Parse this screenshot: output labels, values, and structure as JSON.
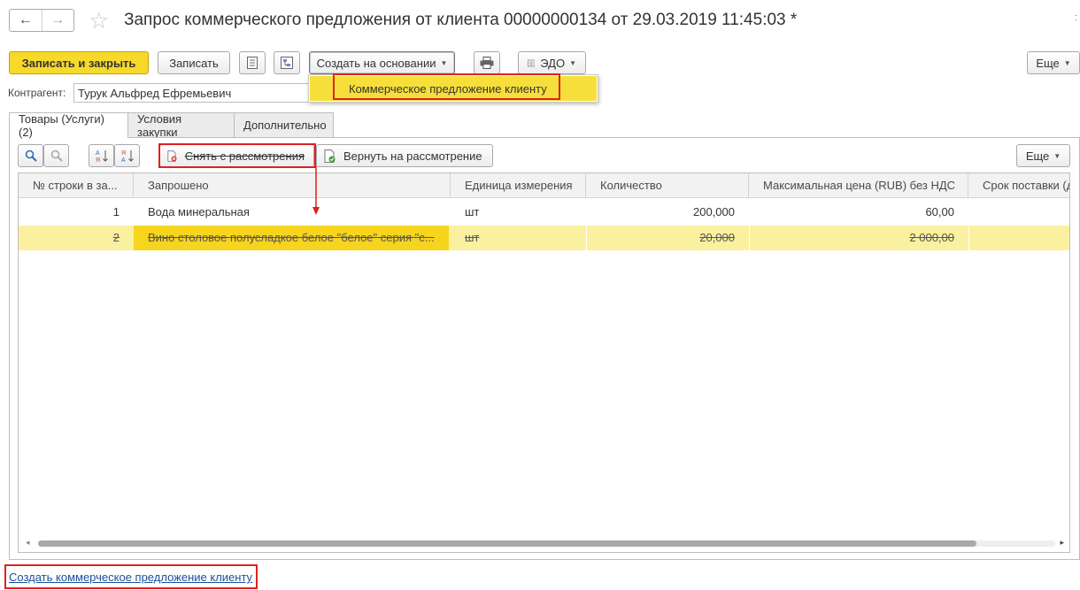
{
  "window": {
    "title": "Запрос коммерческого предложения от клиента 00000000134 от 29.03.2019 11:45:03 *",
    "back_glyph": "←",
    "forward_glyph": "→",
    "star_glyph": "☆",
    "close_glyph": ":"
  },
  "toolbar": {
    "save_close": "Записать и закрыть",
    "save": "Записать",
    "create_basis": "Создать на основании",
    "edo": "ЭДО",
    "more": "Еще"
  },
  "create_menu": {
    "items": [
      "Коммерческое предложение клиенту"
    ]
  },
  "counterparty": {
    "label": "Контрагент:",
    "value": "Турук Альфред Ефремьевич"
  },
  "tabs": [
    "Товары (Услуги) (2)",
    "Условия закупки",
    "Дополнительно"
  ],
  "goods_toolbar": {
    "remove_from_review": "Снять с рассмотрения",
    "return_to_review": "Вернуть на рассмотрение",
    "more": "Еще"
  },
  "table": {
    "columns": [
      "№ строки в за...",
      "Запрошено",
      "Единица измерения",
      "Количество",
      "Максимальная цена (RUB) без НДС",
      "Срок поставки (д"
    ],
    "rows": [
      {
        "n": "1",
        "item": "Вода минеральная",
        "unit": "шт",
        "qty": "200,000",
        "price": "60,00",
        "term": ""
      },
      {
        "n": "2",
        "item": "Вино столовое полусладкое белое \"белое\" серия \"с...",
        "unit": "шт",
        "qty": "20,000",
        "price": "2 000,00",
        "term": ""
      }
    ]
  },
  "footer": {
    "create_offer_link": "Создать коммерческое предложение клиенту"
  },
  "colors": {
    "accent_yellow": "#f6d92a",
    "selection": "#fbf0a0",
    "highlight": "#e02020",
    "link": "#1a4f9c"
  }
}
